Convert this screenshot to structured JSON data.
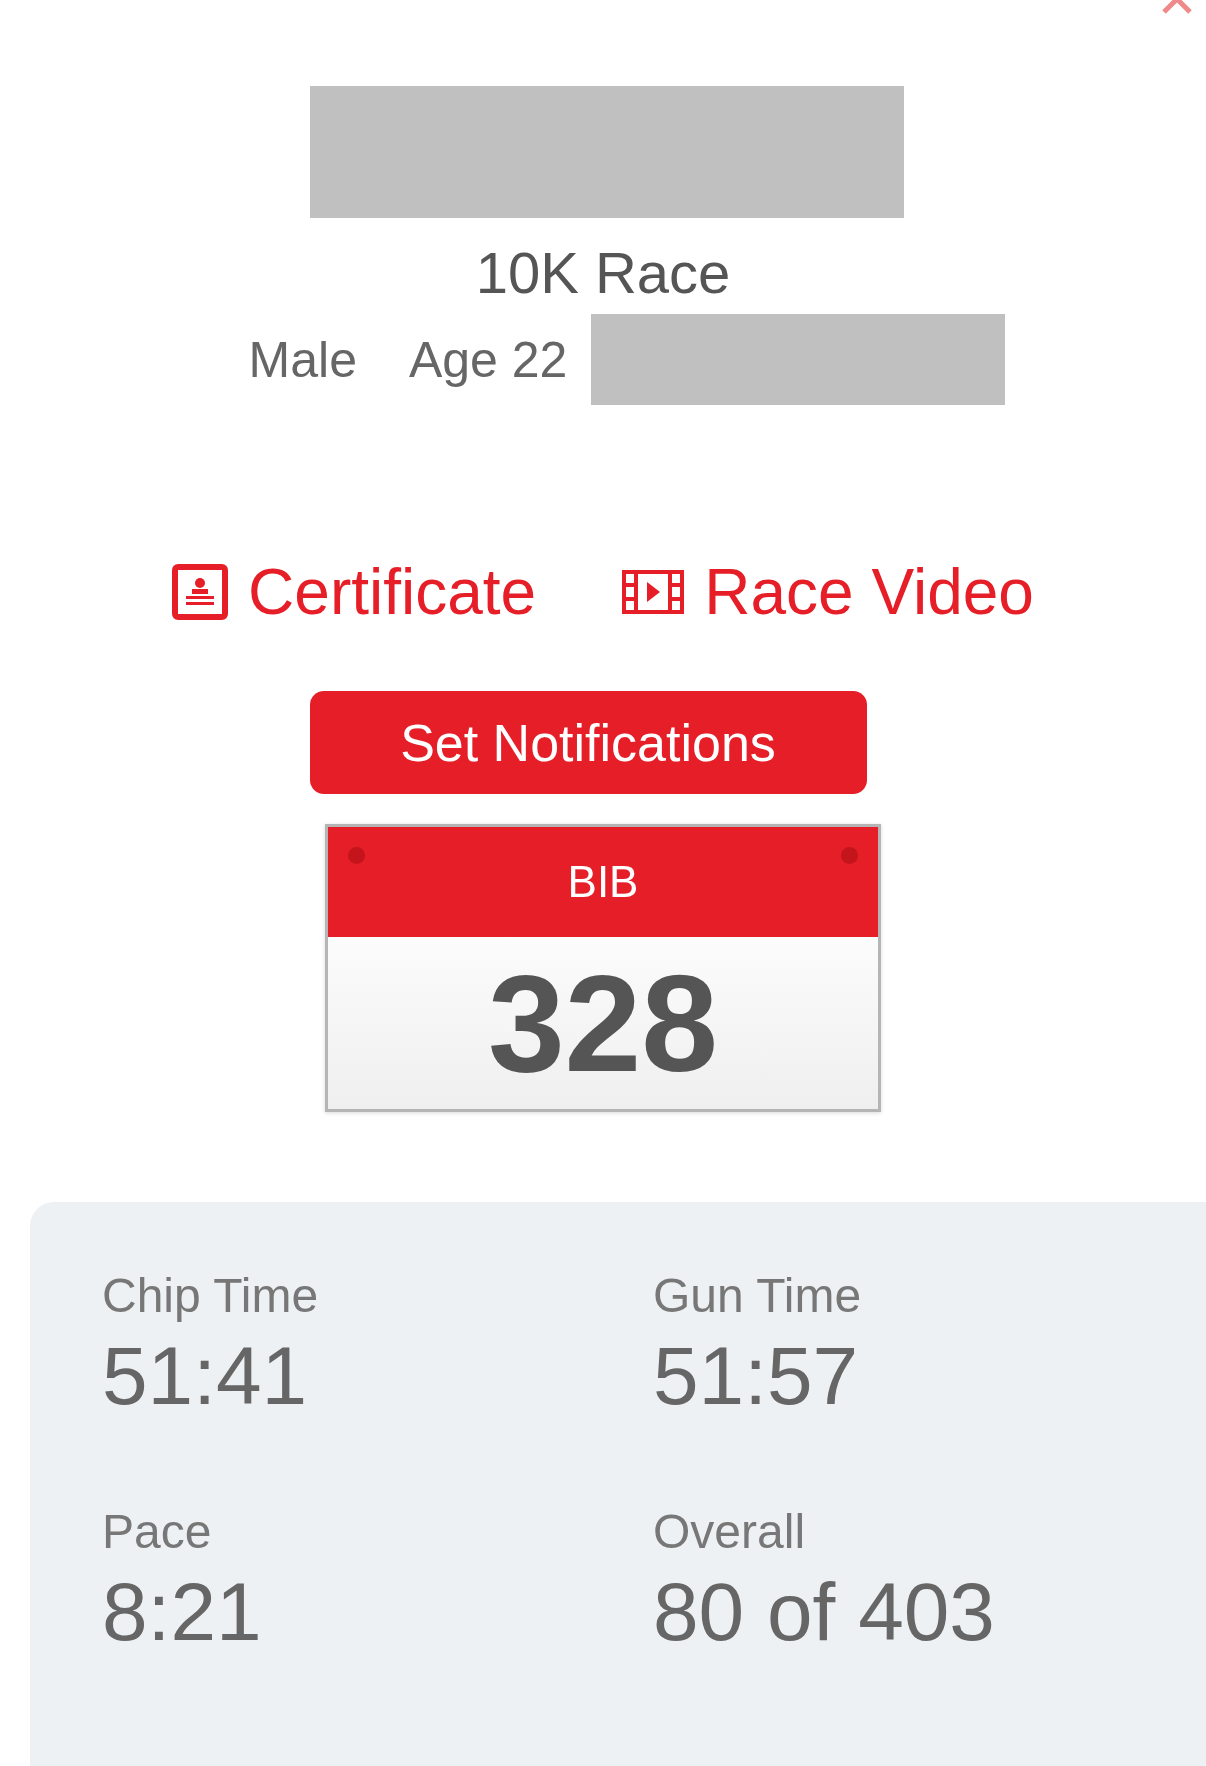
{
  "event": {
    "name": "10K Race",
    "gender": "Male",
    "age": "Age 22"
  },
  "links": [
    {
      "kind": "certificate",
      "label": "Certificate"
    },
    {
      "kind": "video",
      "label": "Race Video"
    }
  ],
  "notify_button": "Set Notifications",
  "bib": {
    "label": "BIB",
    "number": "328"
  },
  "stats": [
    {
      "label": "Chip Time",
      "value": "51:41"
    },
    {
      "label": "Gun Time",
      "value": "51:57"
    },
    {
      "label": "Pace",
      "value": "8:21"
    },
    {
      "label": "Overall",
      "value": "80 of 403"
    }
  ]
}
